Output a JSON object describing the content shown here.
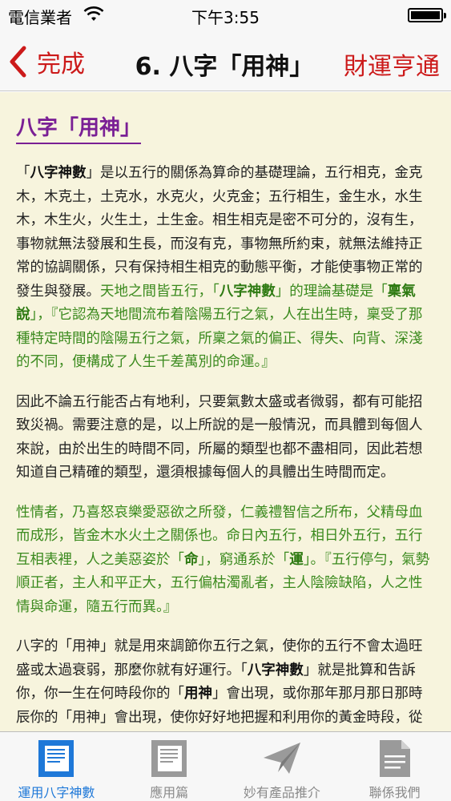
{
  "status": {
    "carrier": "電信業者",
    "time": "下午3:55"
  },
  "nav": {
    "back_label": "完成",
    "title": "6. 八字「用神」",
    "right_label": "財運亨通"
  },
  "article": {
    "heading": "八字「用神」",
    "p1": {
      "t1": "「",
      "b1": "八字神數",
      "t2": "」是以五行的關係為算命的基礎理論，五行相克，金克木，木克土，土克水，水克火，火克金；五行相生，金生水，水生木，木生火，火生土，土生金。相生相克是密不可分的，沒有生，事物就無法發展和生長，而沒有克，事物無所約束，就無法維持正常的協調關係，只有保持相生相克的動態平衡，才能使事物正常的發生與發展。",
      "g1": "天地之間皆五行，「",
      "gb1": "八字神數",
      "g2": "」的理論基礎是「",
      "gb2": "稟氣說",
      "g3": "」，『它認為天地間流布着陰陽五行之氣，人在出生時，稟受了那種特定時間的陰陽五行之氣，所稟之氣的偏正、得失、向背、深淺的不同，便構成了人生千差萬別的命運。』"
    },
    "p2": "因此不論五行能否占有地利，只要氣數太盛或者微弱，都有可能招致災禍。需要注意的是，以上所說的是一般情況，而具體到每個人來說，由於出生的時間不同，所屬的類型也都不盡相同，因此若想知道自己精確的類型，還須根據每個人的具體出生時間而定。",
    "p3": {
      "t1": "性情者，乃喜怒哀樂愛惡欲之所發，仁義禮智信之所布，父精母血而成形，皆金木水火土之關係也。命日內五行，相日外五行，五行互相表裡，人之美惡姿於「",
      "b1": "命",
      "t2": "」，窮通系於「",
      "b2": "運",
      "t3": "」。『五行停勻，氣勢順正者，主人和平正大，五行偏枯濁亂者，主人陰險缺陷，人之性情與命運，隨五行而異。』"
    },
    "p4": {
      "t1": "八字的「用神」就是用來調節你五行之氣，使你的五行不會太過旺盛或太過衰弱，那麼你就有好運行。「",
      "b1": "八字神數",
      "t2": "」就是批算和告訴你，你一生在何時段你的「",
      "b2": "用神",
      "t3": "」會出現，或你那年那月那日那時辰你的「用神」會出現，使你好好地把握和利用你的黃金時段，從而幫助你趨吉避凶，事業成功，名成利就，財運亨通，家運昌盛，身心健康快樂。"
    }
  },
  "tabs": [
    {
      "label": "運用八字神數",
      "icon": "document-icon",
      "active": true
    },
    {
      "label": "應用篇",
      "icon": "notes-icon",
      "active": false
    },
    {
      "label": "妙有產品推介",
      "icon": "paper-plane-icon",
      "active": false
    },
    {
      "label": "聯係我們",
      "icon": "file-icon",
      "active": false
    }
  ],
  "colors": {
    "accent_red": "#cc1a1a",
    "heading_purple": "#7a1f95",
    "quote_green": "#3b8a1e",
    "active_tab_blue": "#1e78d8",
    "content_bg": "#f7f4dd"
  }
}
